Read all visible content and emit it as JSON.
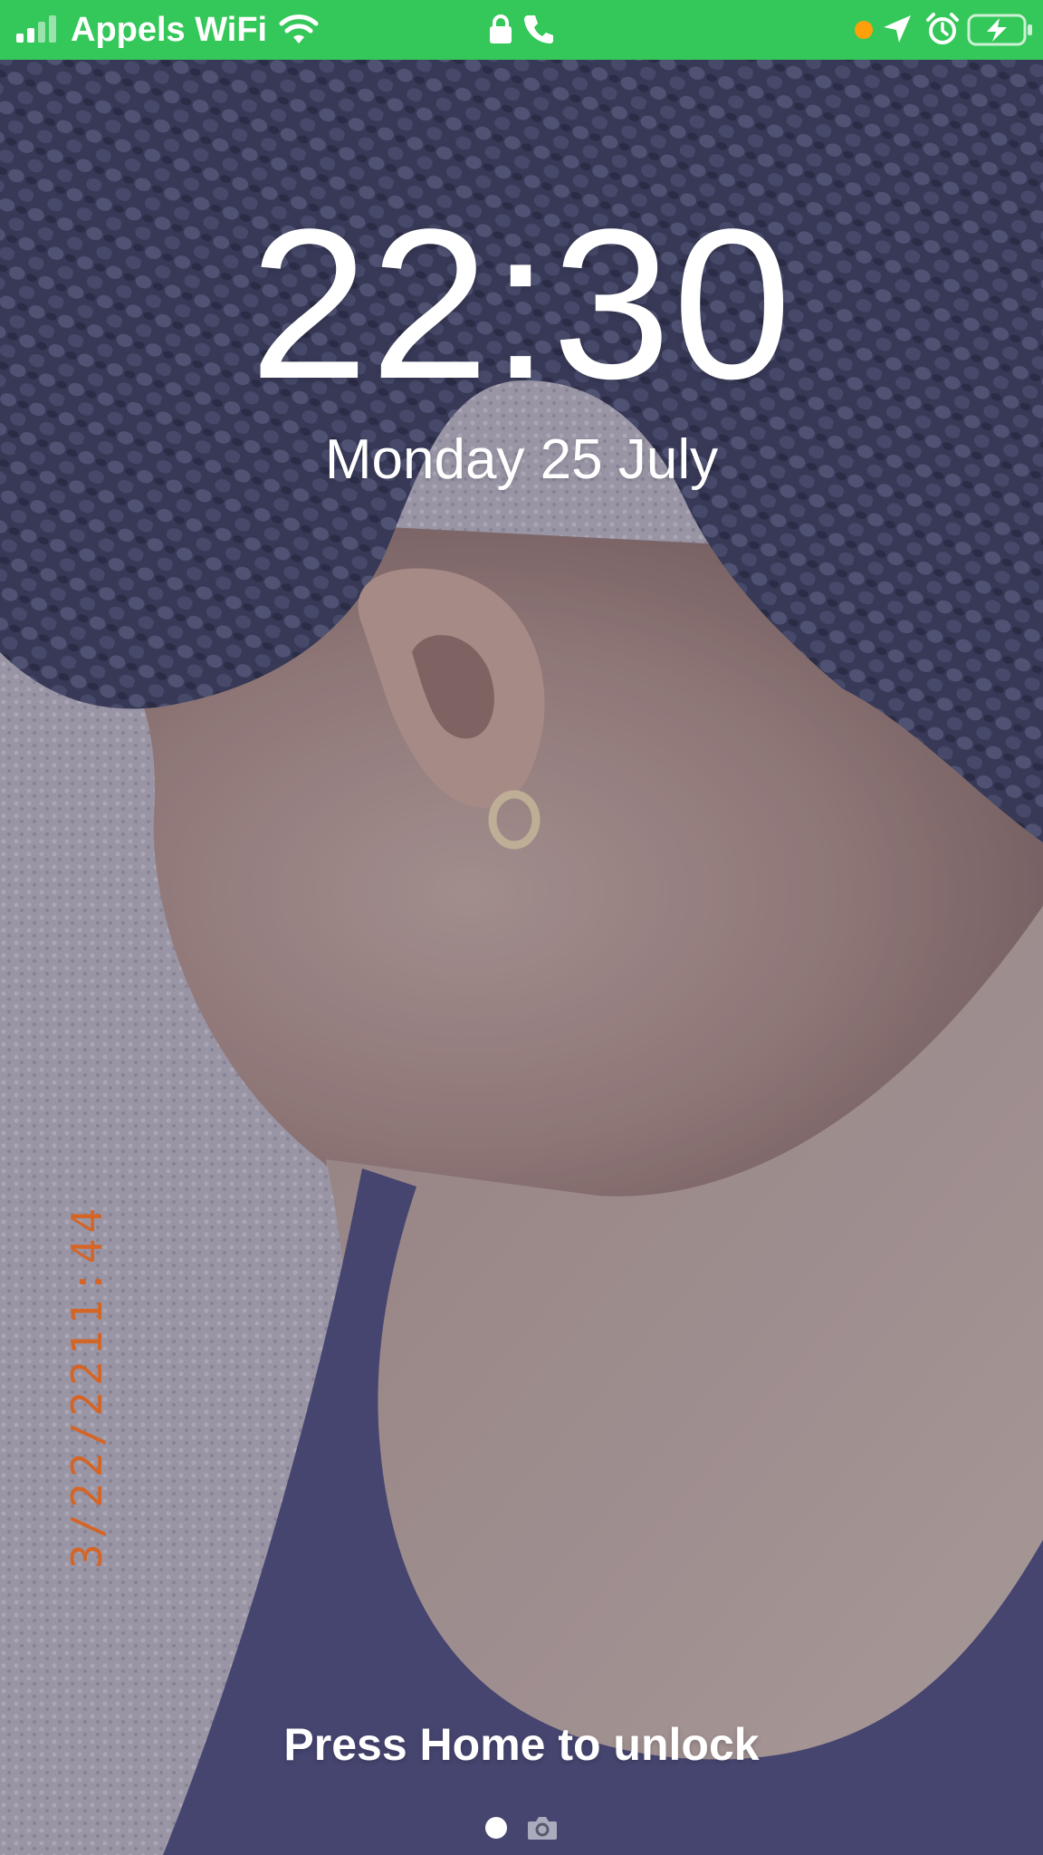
{
  "status_bar": {
    "background": "#34c759",
    "carrier": "Appels WiFi",
    "icons": [
      "signal-icon",
      "wifi-icon",
      "lock-icon",
      "phone-icon",
      "mic-indicator-dot",
      "location-icon",
      "alarm-icon",
      "battery-charging-icon"
    ],
    "mic_indicator_color": "#ff9f0a"
  },
  "lock_screen": {
    "time": "22:30",
    "date": "Monday 25 July",
    "unlock_hint": "Press Home to unlock"
  },
  "wallpaper": {
    "photo_stamp": "3/22/2211:44"
  },
  "bottom": {
    "page_indicator": "page-dot-active",
    "camera_shortcut": "camera-icon"
  }
}
